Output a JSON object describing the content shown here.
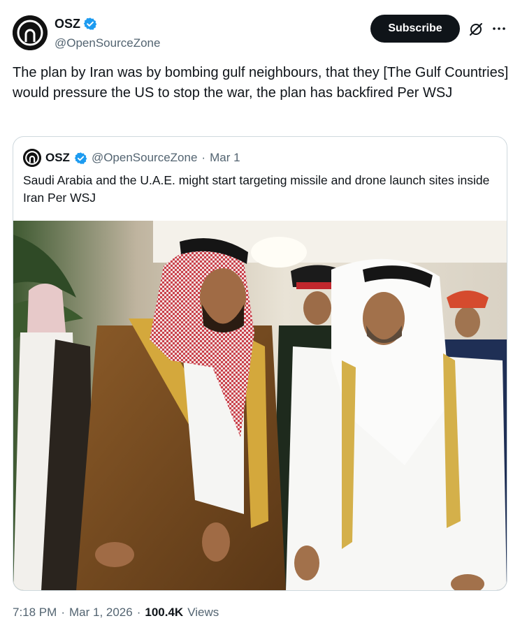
{
  "author": {
    "display_name": "OSZ",
    "handle": "@OpenSourceZone",
    "avatar": "open-source-logo",
    "verified": true,
    "verified_color": "#1d9bf0"
  },
  "actions": {
    "subscribe_label": "Subscribe",
    "grok_icon": "grok-icon",
    "more_icon": "more-icon"
  },
  "tweet": {
    "text": "The plan by Iran was by bombing gulf neighbours, that they [The Gulf Countries] would pressure the US to stop the war, the plan has backfired Per WSJ"
  },
  "quote": {
    "display_name": "OSZ",
    "handle": "@OpenSourceZone",
    "separator": "·",
    "date": "Mar 1",
    "text": "Saudi Arabia and the U.A.E. might start targeting missile and drone launch sites inside Iran Per WSJ",
    "media": "photo"
  },
  "meta": {
    "time": "7:18 PM",
    "separator": "·",
    "date": "Mar 1, 2026",
    "views_count": "100.4K",
    "views_label": "Views"
  },
  "colors": {
    "text_primary": "#0f1419",
    "text_secondary": "#536471",
    "border": "#cfd9de",
    "button_bg": "#0f1419"
  }
}
